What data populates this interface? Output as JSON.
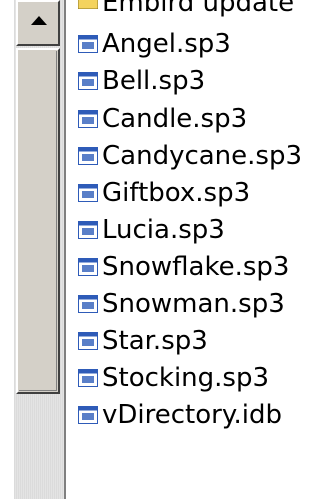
{
  "scrollbar": {
    "up_arrow_icon": "triangle-up"
  },
  "file_list": {
    "items": [
      {
        "label": "Embird update",
        "icon": "folder-icon"
      },
      {
        "label": "Angel.sp3",
        "icon": "document-icon"
      },
      {
        "label": "Bell.sp3",
        "icon": "document-icon"
      },
      {
        "label": "Candle.sp3",
        "icon": "document-icon"
      },
      {
        "label": "Candycane.sp3",
        "icon": "document-icon"
      },
      {
        "label": "Giftbox.sp3",
        "icon": "document-icon"
      },
      {
        "label": "Lucia.sp3",
        "icon": "document-icon"
      },
      {
        "label": "Snowflake.sp3",
        "icon": "document-icon"
      },
      {
        "label": "Snowman.sp3",
        "icon": "document-icon"
      },
      {
        "label": "Star.sp3",
        "icon": "document-icon"
      },
      {
        "label": "Stocking.sp3",
        "icon": "document-icon"
      },
      {
        "label": "vDirectory.idb",
        "icon": "document-icon"
      }
    ]
  },
  "colors": {
    "icon_blue": "#2e5bb8",
    "icon_face": "#ffffff"
  }
}
